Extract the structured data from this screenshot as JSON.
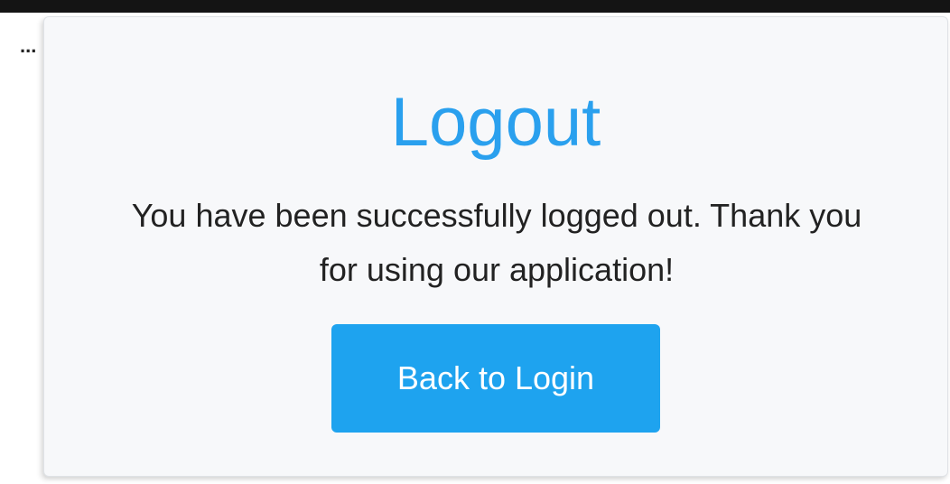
{
  "ellipsis": "...",
  "logout_card": {
    "title": "Logout",
    "message": "You have been successfully logged out. Thank you for using our application!",
    "button_label": "Back to Login"
  },
  "colors": {
    "title": "#2aa0ee",
    "button_bg": "#1ea3ef",
    "card_bg": "#f7f8fa",
    "top_bar": "#141414"
  }
}
